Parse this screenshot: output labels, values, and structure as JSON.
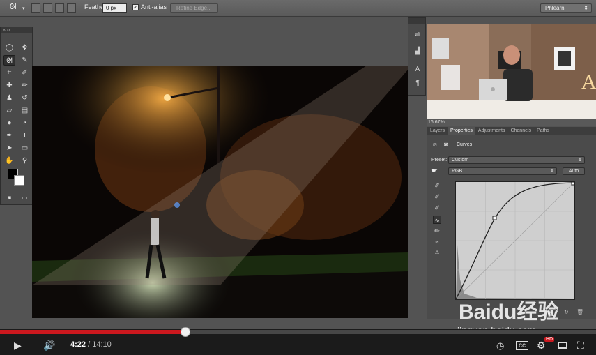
{
  "options_bar": {
    "feather_label": "Feather:",
    "feather_value": "0 px",
    "antialias_label": "Anti-alias",
    "refine_edge_label": "Refine Edge...",
    "workspace_value": "Phlearn"
  },
  "video_overlay": {
    "zoom": "16.67%"
  },
  "properties": {
    "tabs": [
      "Layers",
      "Properties",
      "Adjustments",
      "Channels",
      "Paths"
    ],
    "active_tab": "Properties",
    "adjustment_title": "Curves",
    "preset_label": "Preset:",
    "preset_value": "Custom",
    "channel_value": "RGB",
    "auto_label": "Auto"
  },
  "player": {
    "current_time": "4:22",
    "separator": " / ",
    "duration": "14:10",
    "progress": 0.311,
    "hd_badge": "HD"
  },
  "watermark": {
    "brand": "Baidu经验",
    "url": "jingyan.baidu.com"
  },
  "colors": {
    "progress": "#cc181e",
    "panel": "#4b4b4b",
    "stage": "#535353"
  }
}
